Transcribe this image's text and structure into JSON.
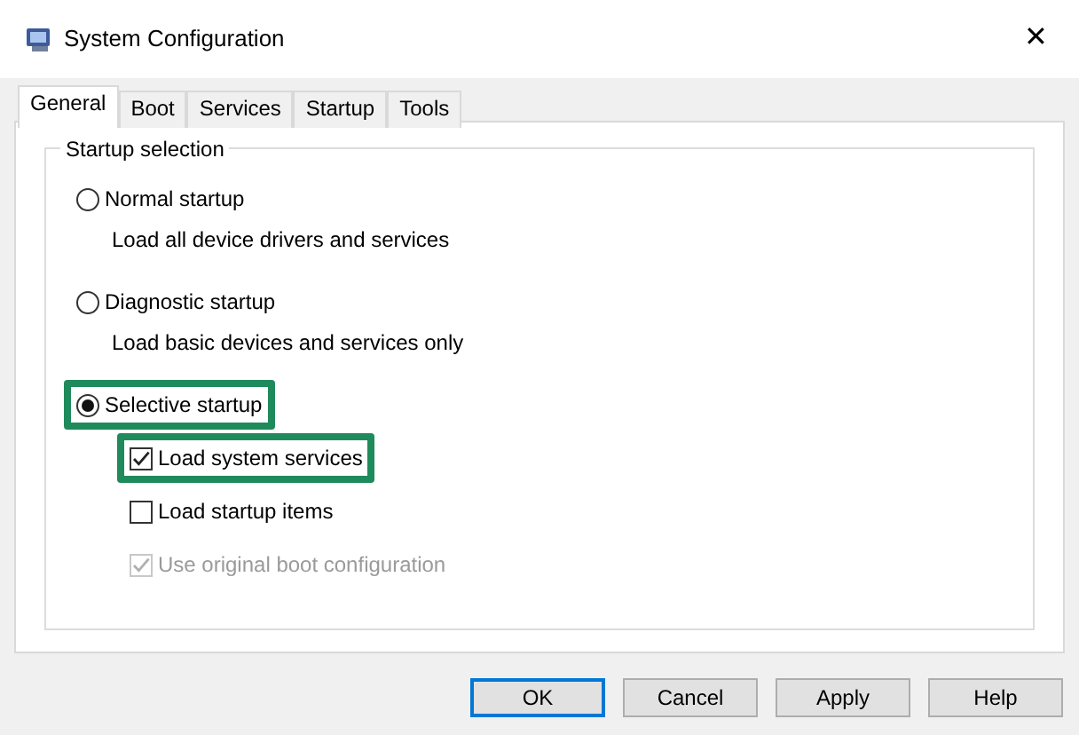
{
  "window": {
    "title": "System Configuration",
    "close_glyph": "✕"
  },
  "tabs": [
    {
      "label": "General",
      "selected": true
    },
    {
      "label": "Boot",
      "selected": false
    },
    {
      "label": "Services",
      "selected": false
    },
    {
      "label": "Startup",
      "selected": false
    },
    {
      "label": "Tools",
      "selected": false
    }
  ],
  "group": {
    "title": "Startup selection",
    "options": [
      {
        "kind": "radio",
        "label": "Normal startup",
        "description": "Load all device drivers and services",
        "selected": false,
        "highlighted": false
      },
      {
        "kind": "radio",
        "label": "Diagnostic startup",
        "description": "Load basic devices and services only",
        "selected": false,
        "highlighted": false
      },
      {
        "kind": "radio",
        "label": "Selective startup",
        "selected": true,
        "highlighted": true
      },
      {
        "kind": "checkbox",
        "label": "Load system services",
        "checked": true,
        "disabled": false,
        "highlighted": true
      },
      {
        "kind": "checkbox",
        "label": "Load startup items",
        "checked": false,
        "disabled": false,
        "highlighted": false
      },
      {
        "kind": "checkbox",
        "label": "Use original boot configuration",
        "checked": true,
        "disabled": true,
        "highlighted": false
      }
    ]
  },
  "buttons": [
    {
      "label": "OK",
      "default": true
    },
    {
      "label": "Cancel",
      "default": false
    },
    {
      "label": "Apply",
      "default": false
    },
    {
      "label": "Help",
      "default": false
    }
  ]
}
